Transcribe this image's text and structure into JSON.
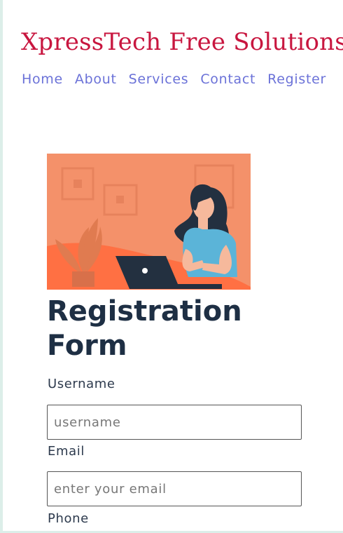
{
  "site": {
    "title": "XpressTech Free Solutions"
  },
  "nav": {
    "items": [
      "Home",
      "About",
      "Services",
      "Contact",
      "Register"
    ]
  },
  "illustration": {
    "icon": "person-with-laptop-illustration"
  },
  "form": {
    "title": "Registration Form",
    "username": {
      "label": "Username",
      "placeholder": "username"
    },
    "email": {
      "label": "Email",
      "placeholder": "enter your email"
    },
    "phone": {
      "label": "Phone"
    }
  },
  "colors": {
    "title": "#c8163f",
    "nav": "#6b72d8",
    "heading": "#1e2f44",
    "illustration_bg": "#f4916a",
    "shirt": "#5bb4d8"
  }
}
